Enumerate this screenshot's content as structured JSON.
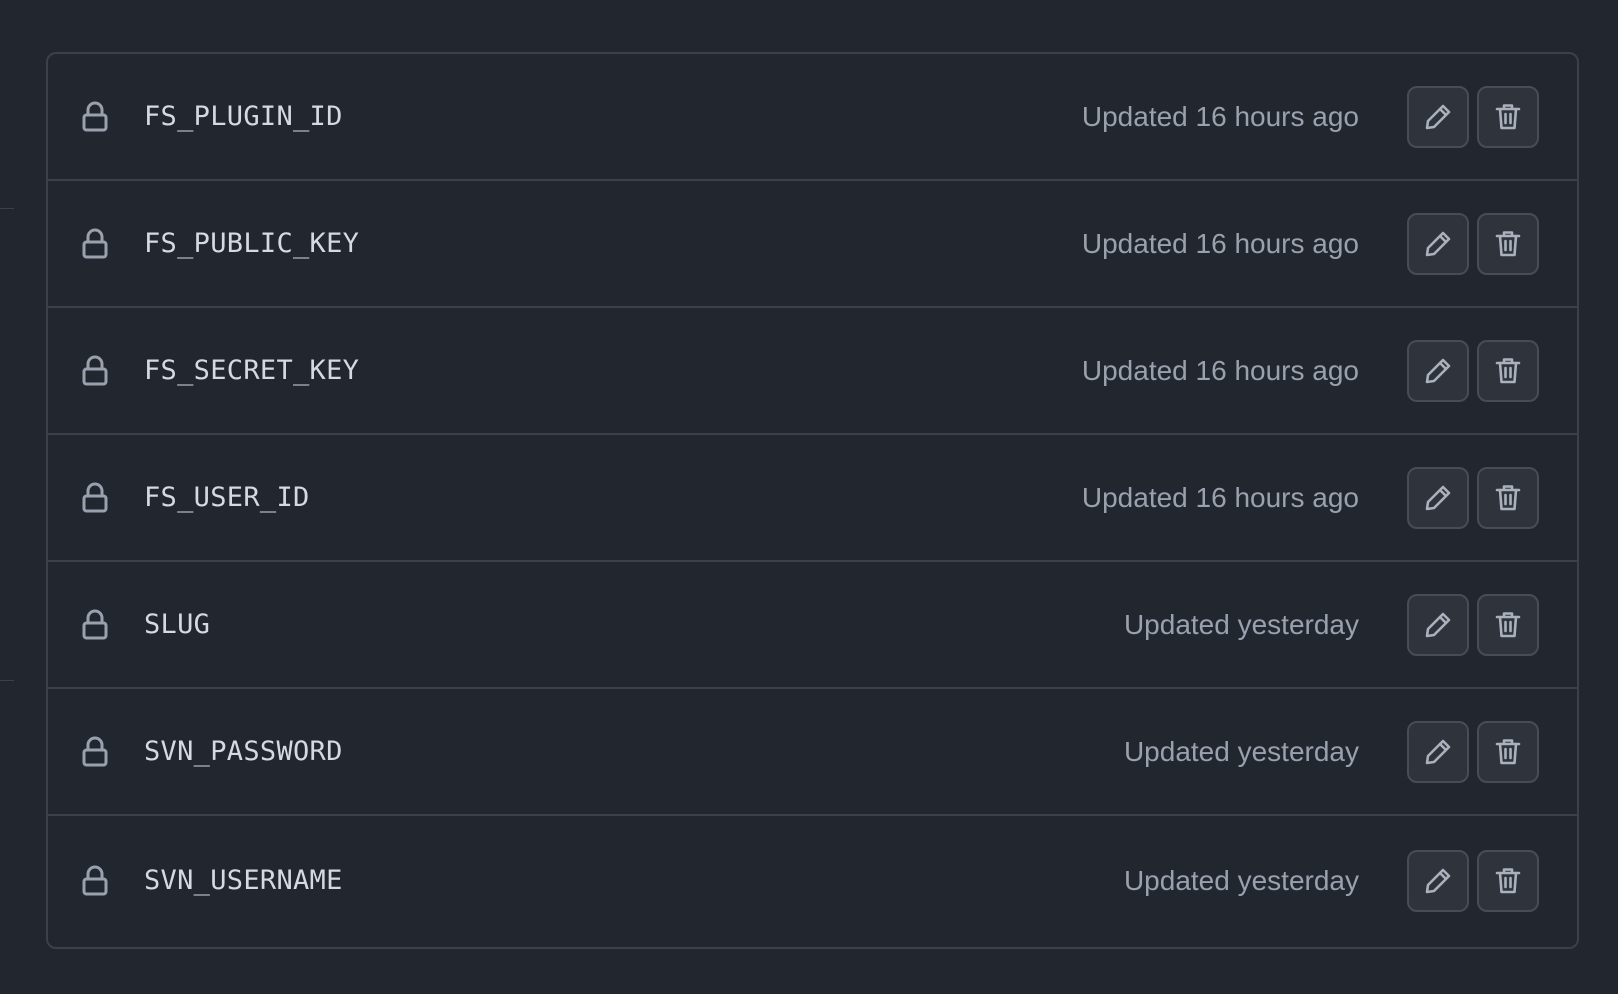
{
  "secrets": [
    {
      "name": "FS_PLUGIN_ID",
      "updated": "Updated 16 hours ago"
    },
    {
      "name": "FS_PUBLIC_KEY",
      "updated": "Updated 16 hours ago"
    },
    {
      "name": "FS_SECRET_KEY",
      "updated": "Updated 16 hours ago"
    },
    {
      "name": "FS_USER_ID",
      "updated": "Updated 16 hours ago"
    },
    {
      "name": "SLUG",
      "updated": "Updated yesterday"
    },
    {
      "name": "SVN_PASSWORD",
      "updated": "Updated yesterday"
    },
    {
      "name": "SVN_USERNAME",
      "updated": "Updated yesterday"
    }
  ],
  "icons": {
    "row": "lock-icon",
    "edit": "pencil-icon",
    "delete": "trash-icon"
  },
  "colors": {
    "background": "#22262f",
    "border": "#3b414b",
    "name_text": "#d5dae1",
    "muted_text": "#98a1ad",
    "button_bg": "#2e333c"
  }
}
